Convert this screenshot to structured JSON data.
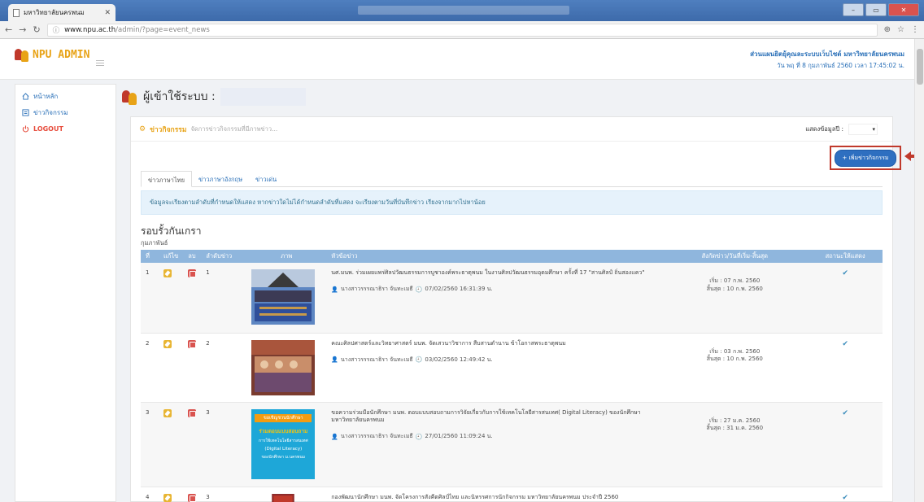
{
  "browser": {
    "tab_title": "มหาวิทยาลัยนครพนม",
    "url_host": "www.npu.ac.th",
    "url_path": "/admin/?page=event_news"
  },
  "header": {
    "logo_text": "NPU ADMIN",
    "org_name": "ส่วนแผนยิตยุ้คุณละระบบเว็บไซต์ มหาวิทยาลัยนครพนม",
    "datetime": "วัน พฤ ที่ 8 กุมภาพันธ์ 2560  เวลา 17:45:02  น."
  },
  "sidebar": {
    "items": [
      {
        "label": "หน้าหลัก",
        "icon": "home-icon"
      },
      {
        "label": "ข่าวกิจกรรม",
        "icon": "news-icon"
      },
      {
        "label": "LOGOUT",
        "icon": "power-icon"
      }
    ]
  },
  "main": {
    "user_label": "ผู้เข้าใช้ระบบ :",
    "card_title": "ข่าวกิจกรรม",
    "card_subtitle": "จัดการข่าวกิจกรรมที่มีภาพข่าว...",
    "filter_label": "แสดงข้อมูลปี :",
    "add_button": "+ เพิ่มข่าวกิจกรรม",
    "tabs": [
      "ข่าวภาษาไทย",
      "ข่าวภาษาอังกฤษ",
      "ข่าวเด่น"
    ],
    "info_text": "ข้อมูลจะเรียงตามลำดับที่กำหนดให้แสดง หากข่าวใดไม่ได้กำหนดลำดับที่แสดง จะเรียงตามวันที่บันทึกข่าว เรียงจากมากไปหาน้อย",
    "section_title": "รอบรั้วกันเกรา",
    "section_month": "กุมภาพันธ์"
  },
  "table": {
    "headers": [
      "ที่",
      "แก้ไข",
      "ลบ",
      "ลำดับข่าว",
      "ภาพ",
      "หัวข้อข่าว",
      "สังกัดข่าว/วันที่เริ่ม-สิ้นสุด",
      "สถานะให้แสดง"
    ],
    "rows": [
      {
        "no": "1",
        "order": "1",
        "title": "นศ.มนพ. ร่วมเผยแพร่ศิลปวัฒนธรรมการบูชาองค์พระธาตุพนม ในงานศิลปวัฒนธรรมอุดมศึกษา ครั้งที่ 17 \"สานศิลป์ ถิ่นสองแคว\"",
        "author": "นางสาวรรรณาธิรา จันทะเมธี",
        "time": "07/02/2560 16:31:39 น.",
        "start": "เริ่ม : 07 ก.พ. 2560",
        "end": "สิ้นสุด : 10 ก.พ. 2560",
        "status": "✔"
      },
      {
        "no": "2",
        "order": "2",
        "title": "คณะศิลปศาสตร์และวิทยาศาสตร์ มนพ. จัดเสวนาวิชาการ สืบสานตำนาน ข้าโอกาสพระธาตุพนม",
        "author": "นางสาวรรรณาธิรา จันทะเมธี",
        "time": "03/02/2560 12:49:42 น.",
        "start": "เริ่ม : 03 ก.พ. 2560",
        "end": "สิ้นสุด : 10 ก.พ. 2560",
        "status": "✔"
      },
      {
        "no": "3",
        "order": "3",
        "title": "ขอความร่วมมือนักศึกษา มนพ. ตอบแบบสอบถามการวิจัยเกี่ยวกับการใช้เทคโนโลยีสารสนเทศ( Digital Literacy) ของนักศึกษามหาวิทยาลัยนครพนม",
        "author": "นางสาวรรรณาธิรา จันทะเมธี",
        "time": "27/01/2560 11:09:24 น.",
        "start": "เริ่ม : 27 ม.ค. 2560",
        "end": "สิ้นสุด : 31 ม.ค. 2560",
        "status": "✔"
      },
      {
        "no": "4",
        "order": "3",
        "title": "กองพัฒนานักศึกษา มนพ. จัดโครงการสังคีตศิลป์ไทย และนิทรรศการนักกิจกรรม มหาวิทยาลัยนครพนม ประจำปี 2560",
        "author": "",
        "time": "",
        "start": "",
        "end": "",
        "status": "✔"
      }
    ],
    "thumb3_lines": [
      "ขอเชิญชวนนักศึกษา",
      "ร่วมตอบแบบสอบถาม",
      "การใช้เทคโนโลยีสารสนเทศ",
      "(Digital Literacy)",
      "ของนักศึกษา ม.นครพนม"
    ]
  }
}
